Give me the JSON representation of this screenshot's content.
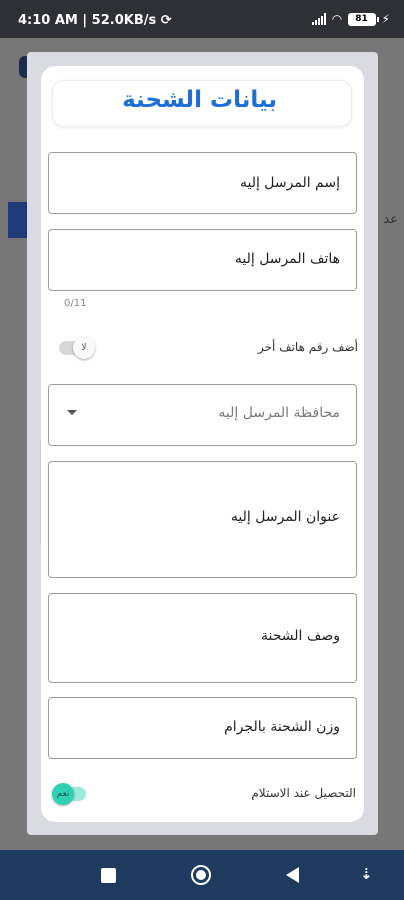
{
  "status_bar": {
    "time": "4:10 AM",
    "network_speed": "52.0KB/s",
    "battery": "81"
  },
  "dialog": {
    "title": "بيانات الشحنة",
    "fields": {
      "recipient_name": "إسم المرسل إليه",
      "recipient_phone": "هاتف المرسل إليه",
      "phone_counter": "0/11",
      "add_phone_label": "أضف رقم هاتف أخر",
      "add_phone_toggle": "لا",
      "governorate_placeholder": "محافظة المرسل إليه",
      "recipient_address": "عنوان المرسل إليه",
      "shipment_description": "وصف الشحنة",
      "shipment_weight": "وزن الشحنة بالجرام",
      "cod_label": "التحصيل عند الاستلام",
      "cod_toggle": "نعم"
    },
    "colors": {
      "title": "#1d6fd6",
      "cod_toggle_on": "#2fd1b4",
      "toggle_off": "#d8d8d8"
    }
  },
  "background": {
    "partial_text": "عد"
  },
  "icons": {
    "dropdown": "arrow-drop-down-icon",
    "nav_recent": "square-icon",
    "nav_home": "circle-home-icon",
    "nav_back": "triangle-back-icon",
    "nav_extra": "arrow-down-icon"
  }
}
